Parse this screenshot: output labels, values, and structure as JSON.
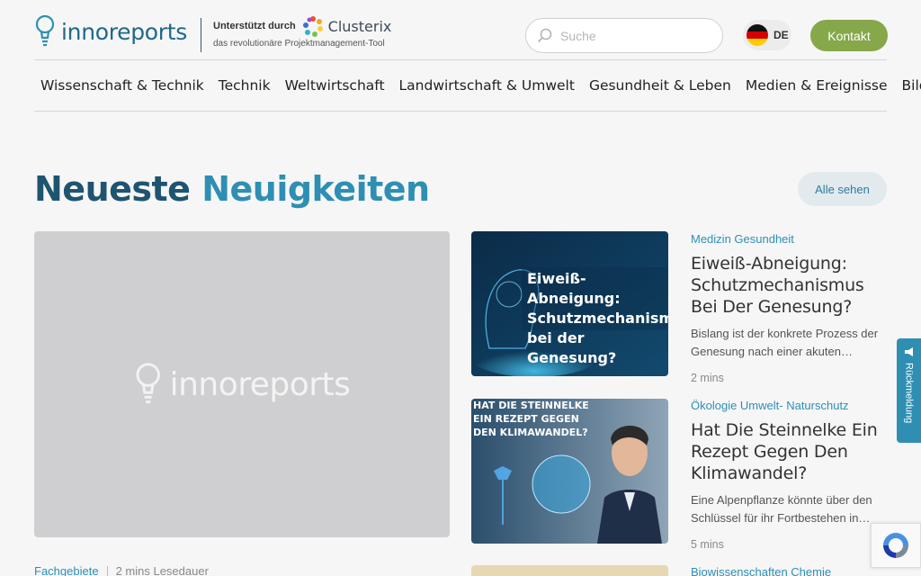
{
  "header": {
    "logo_text": "innoreports",
    "support_label": "Unterstützt durch",
    "support_brand": "Clusterix",
    "support_tagline": "das revolutionäre Projektmanagement-Tool",
    "search_placeholder": "Suche",
    "language": "DE",
    "contact_label": "Kontakt"
  },
  "nav": {
    "items": [
      "Wissenschaft & Technik",
      "Technik",
      "Weltwirtschaft",
      "Landwirtschaft & Umwelt",
      "Gesundheit & Leben",
      "Medien & Ereignisse",
      "Bildung"
    ]
  },
  "section": {
    "title_part1": "Neueste",
    "title_part2": "Neuigkeiten",
    "see_all": "Alle sehen"
  },
  "featured": {
    "placeholder_logo": "innoreports",
    "category": "Fachgebiete",
    "read_time": "2 mins Lesedauer"
  },
  "articles": [
    {
      "category": "Medizin Gesundheit",
      "title": "Eiweiß-Abneigung: Schutzmechanismus Bei Der Genesung?",
      "excerpt": "Bislang ist der konkrete Prozess der Genesung nach einer akuten…",
      "read_time": "2 mins",
      "thumb_text": "Eiweiß-Abneigung: Schutzmechanismus bei der Genesung?"
    },
    {
      "category": "Ökologie Umwelt- Naturschutz",
      "title": "Hat Die Steinnelke Ein Rezept Gegen Den Klimawandel?",
      "excerpt": "Eine Alpenpflanze könnte über den Schlüssel für ihr Fortbestehen in…",
      "read_time": "5 mins",
      "thumb_text": "HAT DIE STEINNELKE EIN REZEPT GEGEN DEN KLIMAWANDEL?"
    },
    {
      "category": "Biowissenschaften Chemie"
    }
  ],
  "feedback_label": "Rückmeldung",
  "colors": {
    "brand_dark": "#1f5470",
    "brand_light": "#2e8fb3",
    "contact_green": "#86a84a"
  }
}
